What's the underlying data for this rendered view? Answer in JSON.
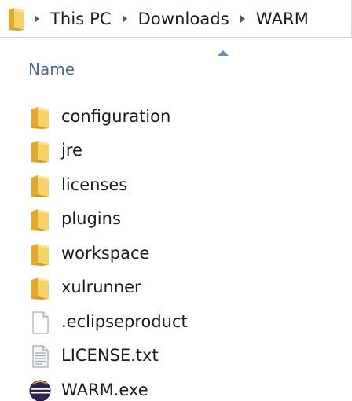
{
  "breadcrumb": {
    "items": [
      "This PC",
      "Downloads",
      "WARM"
    ]
  },
  "column_header": {
    "name_label": "Name",
    "sort_direction": "ascending"
  },
  "files": [
    {
      "name": "configuration",
      "type": "folder"
    },
    {
      "name": "jre",
      "type": "folder"
    },
    {
      "name": "licenses",
      "type": "folder"
    },
    {
      "name": "plugins",
      "type": "folder"
    },
    {
      "name": "workspace",
      "type": "folder"
    },
    {
      "name": "xulrunner",
      "type": "folder"
    },
    {
      "name": ".eclipseproduct",
      "type": "file"
    },
    {
      "name": "LICENSE.txt",
      "type": "text"
    },
    {
      "name": "WARM.exe",
      "type": "exe"
    }
  ],
  "colors": {
    "folder_yellow": "#f3c64a",
    "header_text": "#4d6a8f",
    "sort_arrow": "#5a8fc7"
  }
}
